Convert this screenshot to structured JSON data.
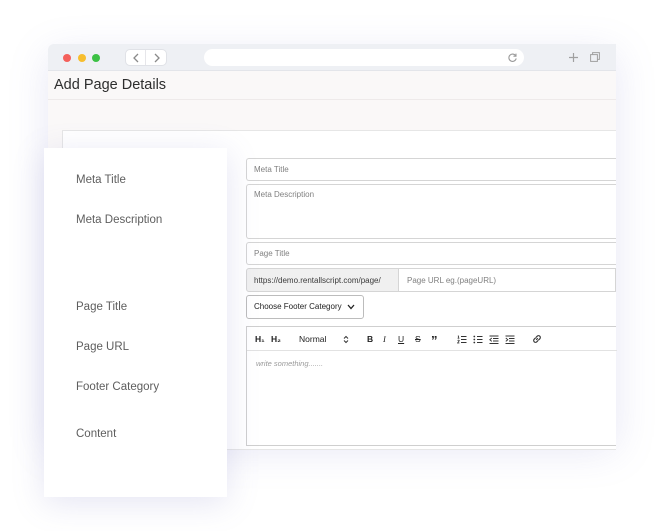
{
  "browser": {
    "icons": [
      "close-dot",
      "minimize-dot",
      "maximize-dot",
      "back-icon",
      "forward-icon",
      "reload-icon",
      "new-tab-icon",
      "tabs-icon"
    ]
  },
  "page": {
    "title": "Add Page Details"
  },
  "labels": {
    "meta_title": "Meta Title",
    "meta_description": "Meta Description",
    "page_title": "Page Title",
    "page_url": "Page URL",
    "footer_category": "Footer Category",
    "content": "Content"
  },
  "form": {
    "meta_title_placeholder": "Meta Title",
    "meta_description_placeholder": "Meta Description",
    "page_title_placeholder": "Page Title",
    "url_prefix": "https://demo.rentallscript.com/page/",
    "url_placeholder": "Page URL  eg.(pageURL)",
    "footer_select": "Choose Footer Category"
  },
  "editor": {
    "toolbar": {
      "h1": "H₁",
      "h2": "H₂",
      "format": "Normal",
      "bold": "B",
      "italic": "I",
      "underline": "U",
      "strike": "S",
      "quote": "”"
    },
    "placeholder": "write something......."
  },
  "colors": {
    "red_dot": "#f4605b",
    "yellow_dot": "#f7be2e",
    "green_dot": "#3cc145",
    "label_text": "#5e5e5e"
  }
}
